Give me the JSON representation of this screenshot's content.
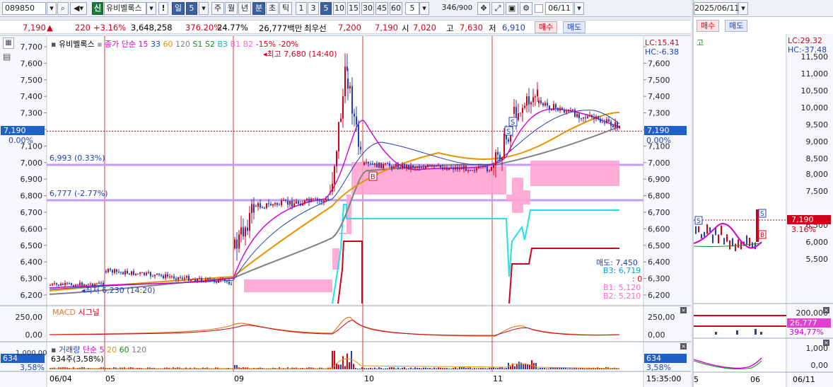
{
  "toolbar": {
    "stock_code": "089850",
    "credit_badge": "신",
    "stock_name": "유비벨록스",
    "period_selected": "일",
    "period_count": "5",
    "period_tabs": [
      "주",
      "월",
      "년",
      "분",
      "초",
      "틱"
    ],
    "period_active_tab": "분",
    "minute_options": [
      "1",
      "3",
      "5",
      "10",
      "15",
      "30",
      "45",
      "60"
    ],
    "minute_active": "5",
    "interval_value": "5",
    "data_count": "346",
    "data_total": "/900",
    "date_input": "06/11",
    "date_input_right": "2025/06/11"
  },
  "quote": {
    "price": "7,190",
    "change_arrow": "▲",
    "change": "220",
    "change_pct": "+3.16%",
    "volume": "3,648,258",
    "volume_ratio": "376.20%",
    "turnover": "24.77%",
    "amount": "26,777백만",
    "best_bid_label": "최우선",
    "best_ask": "7,200",
    "best_bid": "7,190",
    "open_label": "시",
    "open": "7,020",
    "high_label": "고",
    "high": "7,630",
    "low_label": "저",
    "low": "6,910",
    "buy_button": "매수",
    "sell_button": "매도"
  },
  "legend": {
    "name": "유비벨록스",
    "ma_prefix": "종가 단순",
    "ma_periods": [
      "15",
      "33",
      "60",
      "120"
    ],
    "ma_colors": [
      "#d400d4",
      "#1f3fbf",
      "#e89400",
      "#808080"
    ],
    "bands": [
      "S1",
      "S2",
      "B3",
      "B1",
      "B2"
    ],
    "band_colors": [
      "#1a8a1a",
      "#1a8a1a",
      "#00b8d4",
      "#ff66cc",
      "#ff66cc"
    ],
    "pct_minus15": "-15%",
    "pct_minus20": "-20%"
  },
  "annotations": {
    "high_marker": "최고 7,680 (14:40)",
    "low_marker": "최저 6,230 (14:20)",
    "line1_label": "6,993 (0.33%)",
    "line2_label": "6,777 (-2.77%)",
    "sell_line_label": "매도: 7,450",
    "b3_label": "B3: 6,719",
    "zero_label": ": 0",
    "b1_label": "B1: 5,120",
    "b2_label": "B2: 5,210"
  },
  "right_axis": {
    "lc": "LC:15.41",
    "hc": "HC:-6.38",
    "current_price_tag": "7,190",
    "ticks": [
      "7,600",
      "7,500",
      "7,400",
      "7,300",
      "7,100",
      "7,000",
      "6,900",
      "6,800",
      "6,700",
      "6,600",
      "6,500",
      "6,400",
      "6,300",
      "6,200"
    ]
  },
  "left_axis": {
    "ticks": [
      "7,700",
      "7,600",
      "7,500",
      "7,400",
      "7,300",
      "7,100",
      "7,000",
      "6,900",
      "6,800",
      "6,700",
      "6,600",
      "6,500",
      "6,400",
      "6,300",
      "6,200"
    ],
    "current_price_tag": "7,190",
    "current_pct": "0.00%"
  },
  "macd": {
    "label_macd": "MACD",
    "label_signal": "시그널",
    "ticks": [
      "250,00",
      "0,00"
    ]
  },
  "volume": {
    "label": "거래량",
    "label_simple": "단순",
    "ma_periods": [
      "5",
      "20",
      "60",
      "120"
    ],
    "ma_colors": [
      "#d400d4",
      "#e89400",
      "#1a8a1a",
      "#808080"
    ],
    "current": "634주(3,58%)",
    "tick": "1,000,00",
    "tag": "634",
    "tag_pct": "3,58%"
  },
  "x_axis": {
    "labels": [
      "06/04",
      "05",
      "09",
      "10",
      "11"
    ],
    "time": "15:35:00"
  },
  "mini_panel": {
    "buy_button": "매수",
    "sell_button": "매도",
    "legend_label": "고",
    "lc": "LC:29.32",
    "hc": "HC:-37.48",
    "price_ticks": [
      "11,500",
      "11,000",
      "10,500",
      "10,000",
      "9,500",
      "9,000",
      "8,500",
      "8,000",
      "7,500",
      "6,500",
      "6,000",
      "5,500"
    ],
    "price_tag": "7,190",
    "price_pct": "3.16%",
    "volume_ticks": [
      "200,000"
    ],
    "amount_tag": "26,777",
    "amount_pct": "394,77%",
    "macd_ticks": [
      "1,000",
      "0,00"
    ],
    "x_labels": [
      "5",
      "06",
      "06/11"
    ]
  },
  "colors": {
    "up": "#d0021b",
    "down": "#1f3fbf",
    "accent": "#3d5f9e",
    "band_pink": "#ff9fd0",
    "cyan": "#25e0e8",
    "purple_line": "#c49cf5"
  }
}
